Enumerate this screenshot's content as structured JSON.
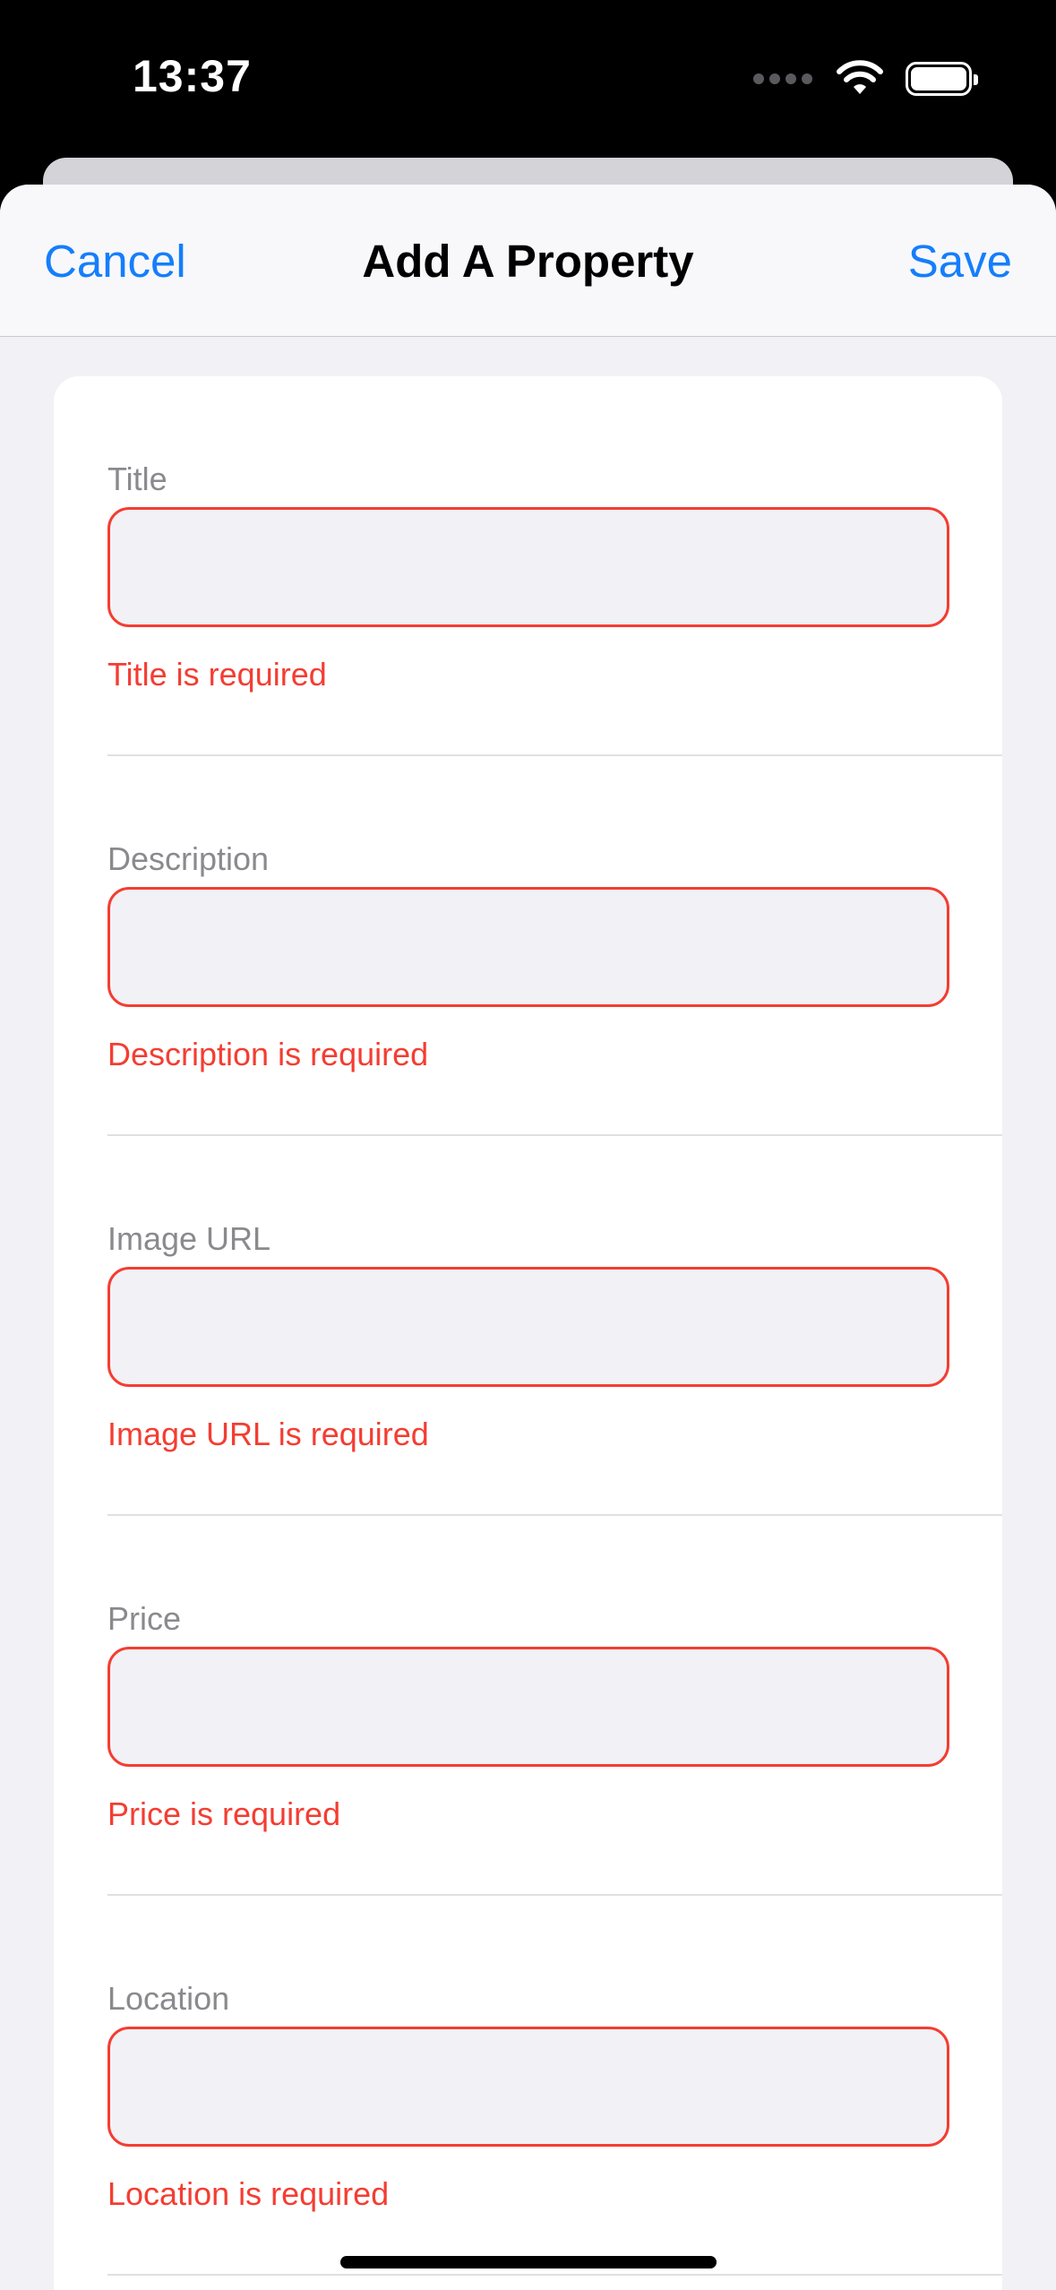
{
  "status_bar": {
    "time": "13:37"
  },
  "nav": {
    "cancel_label": "Cancel",
    "title": "Add A Property",
    "save_label": "Save"
  },
  "form": {
    "fields": [
      {
        "label": "Title",
        "value": "",
        "error": "Title is required"
      },
      {
        "label": "Description",
        "value": "",
        "error": "Description is required"
      },
      {
        "label": "Image URL",
        "value": "",
        "error": "Image URL is required"
      },
      {
        "label": "Price",
        "value": "",
        "error": "Price is required"
      },
      {
        "label": "Location",
        "value": "",
        "error": "Location is required"
      }
    ]
  },
  "colors": {
    "accent": "#157efb",
    "error": "#f43d32",
    "sheet_background": "#f1f1f6",
    "input_background": "#f1f1f6"
  },
  "icons": {
    "cellular": "cellular-signal-icon",
    "wifi": "wifi-icon",
    "battery": "battery-icon"
  }
}
